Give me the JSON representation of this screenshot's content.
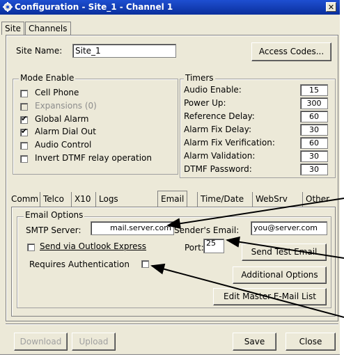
{
  "window": {
    "title": "Configuration - Site_1 - Channel 1",
    "close_glyph": "✕"
  },
  "top_tabs": [
    {
      "label": "Site"
    },
    {
      "label": "Channels"
    }
  ],
  "site": {
    "name_label": "Site Name:",
    "name_value": "Site_1",
    "access_codes_label": "Access Codes..."
  },
  "mode_enable": {
    "title": "Mode Enable",
    "items": [
      {
        "label": "Cell Phone",
        "checked": false,
        "enabled": true
      },
      {
        "label": "Expansions (0)",
        "checked": false,
        "enabled": false
      },
      {
        "label": "Global Alarm",
        "checked": true,
        "enabled": true
      },
      {
        "label": "Alarm Dial Out",
        "checked": true,
        "enabled": true
      },
      {
        "label": "Audio Control",
        "checked": false,
        "enabled": true
      },
      {
        "label": "Invert DTMF relay operation",
        "checked": false,
        "enabled": true
      }
    ]
  },
  "timers": {
    "title": "Timers",
    "items": [
      {
        "label": "Audio Enable:",
        "value": "15"
      },
      {
        "label": "Power Up:",
        "value": "300"
      },
      {
        "label": "Reference Delay:",
        "value": "60"
      },
      {
        "label": "Alarm Fix Delay:",
        "value": "30"
      },
      {
        "label": "Alarm Fix Verification:",
        "value": "60"
      },
      {
        "label": "Alarm Validation:",
        "value": "30"
      },
      {
        "label": "DTMF Password:",
        "value": "30"
      }
    ]
  },
  "sub_tabs": [
    {
      "label": "Comm"
    },
    {
      "label": "Telco"
    },
    {
      "label": "X10"
    },
    {
      "label": "Logs"
    },
    {
      "label": "Email"
    },
    {
      "label": "Time/Date"
    },
    {
      "label": "WebSrv"
    },
    {
      "label": "Other"
    }
  ],
  "email": {
    "group_title": "Email Options",
    "smtp_label": "SMTP Server:",
    "smtp_value": "mail.server.com",
    "sender_label": "Sender's Email:",
    "sender_value": "you@server.com",
    "outlook_label": "Send via Outlook Express",
    "outlook_checked": false,
    "port_label": "Port:",
    "port_value": "25",
    "auth_label": "Requires Authentication",
    "auth_checked": false,
    "send_test_label": "Send Test Email",
    "additional_label": "Additional Options",
    "edit_master_label": "Edit Master E-Mail List"
  },
  "footer": {
    "download_label": "Download",
    "upload_label": "Upload",
    "save_label": "Save",
    "close_label": "Close"
  },
  "icons": {
    "title_icon": "gear-icon",
    "check_glyph": "✔"
  },
  "colors": {
    "titlebar": "#0a2f9c",
    "dialog_bg": "#ece9d8"
  }
}
